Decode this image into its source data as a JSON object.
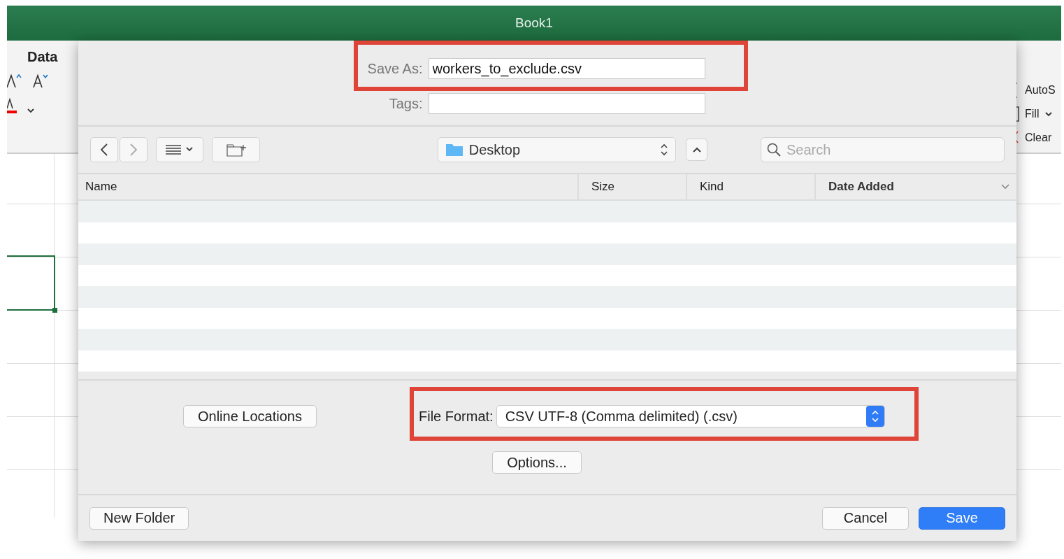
{
  "window": {
    "title": "Book1"
  },
  "ribbon": {
    "tab": "Data",
    "right_items": [
      {
        "label": "AutoS",
        "kind": "bracket"
      },
      {
        "label": "Fill",
        "kind": "fill"
      },
      {
        "label": "Clear",
        "kind": "clear"
      }
    ]
  },
  "dialog": {
    "save_as": {
      "label": "Save As:",
      "value": "workers_to_exclude.csv"
    },
    "tags": {
      "label": "Tags:"
    },
    "location": "Desktop",
    "search": {
      "placeholder": "Search"
    },
    "columns": [
      {
        "label": "Name",
        "sorted": false
      },
      {
        "label": "Size",
        "sorted": false
      },
      {
        "label": "Kind",
        "sorted": false
      },
      {
        "label": "Date Added",
        "sorted": true
      }
    ],
    "file_format": {
      "label": "File Format:",
      "value": "CSV UTF-8 (Comma delimited) (.csv)"
    },
    "online_button": "Online Locations",
    "options_button": "Options...",
    "footer_buttons": [
      {
        "label": "New Folder",
        "kind": "default"
      },
      {
        "label": "Cancel",
        "kind": "default"
      },
      {
        "label": "Save",
        "kind": "primary"
      }
    ]
  }
}
